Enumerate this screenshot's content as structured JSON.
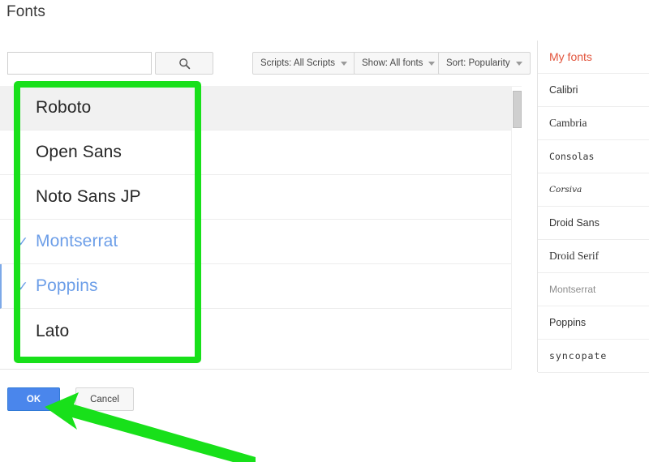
{
  "page": {
    "title": "Fonts"
  },
  "toolbar": {
    "search": {
      "value": "",
      "placeholder": "",
      "icon": "search-icon"
    },
    "search_button_icon": "search-icon",
    "filters": [
      {
        "label": "Scripts: All Scripts",
        "icon": "chevron-down-icon"
      },
      {
        "label": "Show: All fonts",
        "icon": "chevron-down-icon"
      },
      {
        "label": "Sort: Popularity",
        "icon": "chevron-down-icon"
      }
    ]
  },
  "font_list": {
    "scrollbar": "vertical-scrollbar",
    "rows": [
      {
        "name": "Roboto",
        "selected": false,
        "check": "",
        "hovered": true,
        "accented": false
      },
      {
        "name": "Open Sans",
        "selected": false,
        "check": "",
        "hovered": false,
        "accented": false
      },
      {
        "name": "Noto Sans JP",
        "selected": false,
        "check": "",
        "hovered": false,
        "accented": false
      },
      {
        "name": "Montserrat",
        "selected": true,
        "check": "✓",
        "hovered": false,
        "accented": false
      },
      {
        "name": "Poppins",
        "selected": true,
        "check": "✓",
        "hovered": false,
        "accented": true
      },
      {
        "name": "Lato",
        "selected": false,
        "check": "",
        "hovered": false,
        "accented": false
      }
    ]
  },
  "sidebar": {
    "title": "My fonts",
    "title_color": "#e2553d",
    "items": [
      {
        "label": "Calibri",
        "style": ""
      },
      {
        "label": "Cambria",
        "style": "serif"
      },
      {
        "label": "Consolas",
        "style": "mono"
      },
      {
        "label": "Corsiva",
        "style": "italic"
      },
      {
        "label": "Droid Sans",
        "style": ""
      },
      {
        "label": "Droid Serif",
        "style": "serif"
      },
      {
        "label": "Montserrat",
        "style": "muted"
      },
      {
        "label": "Poppins",
        "style": ""
      },
      {
        "label": "syncopate",
        "style": "wide"
      }
    ]
  },
  "footer": {
    "ok_label": "OK",
    "cancel_label": "Cancel"
  },
  "annotations": {
    "highlight_color": "#18e01a",
    "arrow_color": "#18e01a",
    "highlight_target": "font-list-options",
    "arrow_target": "ok-button"
  }
}
